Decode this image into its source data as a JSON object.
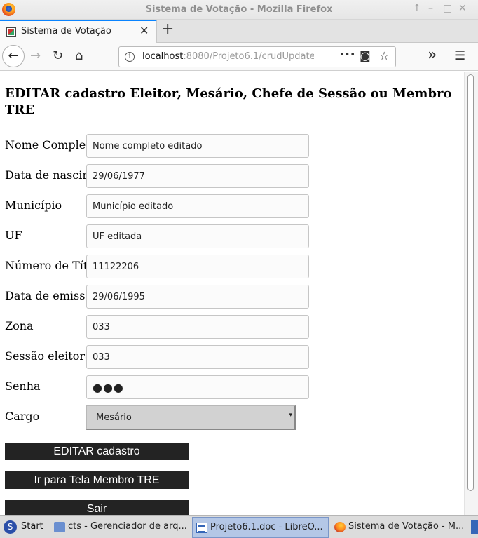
{
  "window": {
    "title": "Sistema de Votação - Mozilla Firefox",
    "controls": [
      "↑",
      "–",
      "□",
      "✕"
    ]
  },
  "tabs": [
    {
      "title": "Sistema de Votação",
      "close": "✕"
    }
  ],
  "new_tab": "+",
  "nav": {
    "back": "←",
    "forward": "→",
    "reload": "↻",
    "home": "⌂",
    "url_host": "localhost",
    "url_rest": ":8080/Projeto6.1/crudUpdate",
    "url_info": "i",
    "page_actions": "•••",
    "pocket": "◙",
    "bookmark": "☆",
    "overflow": "»",
    "menu": "☰"
  },
  "page": {
    "heading": "EDITAR cadastro Eleitor, Mesário, Chefe de Sessão ou Membro TRE",
    "fields": [
      {
        "label": "Nome Completo",
        "value": "Nome completo editado"
      },
      {
        "label": "Data de nascimento",
        "value": "29/06/1977"
      },
      {
        "label": "Município",
        "value": "Município editado"
      },
      {
        "label": "UF",
        "value": "UF editada"
      },
      {
        "label": "Número de Título",
        "value": "11122206"
      },
      {
        "label": "Data de emissão",
        "value": "29/06/1995"
      },
      {
        "label": "Zona",
        "value": "033"
      },
      {
        "label": "Sessão eleitoral",
        "value": "033"
      },
      {
        "label": "Senha",
        "value": "●●●"
      }
    ],
    "cargo": {
      "label": "Cargo",
      "value": "Mesário",
      "arrow": "▾"
    },
    "buttons": {
      "edit": "EDITAR cadastro",
      "membro": "Ir para Tela Membro TRE",
      "exit": "Sair"
    }
  },
  "taskbar": {
    "start": "Start",
    "start_icon": "S",
    "items": [
      {
        "label": "cts - Gerenciador de arq...",
        "icon": "folder-icon"
      },
      {
        "label": "Projeto6.1.doc - LibreO...",
        "icon": "document-icon",
        "active": true
      },
      {
        "label": "Sistema de Votação - M...",
        "icon": "firefox-icon"
      }
    ]
  }
}
